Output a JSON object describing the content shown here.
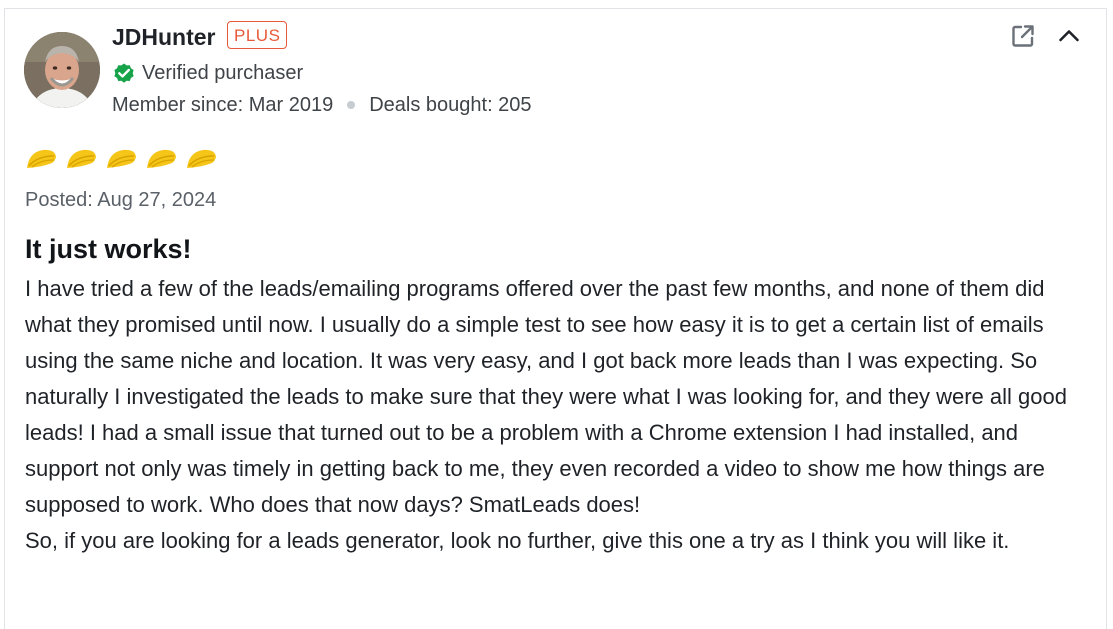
{
  "review": {
    "user": {
      "name": "JDHunter",
      "badge": "PLUS",
      "verified_label": "Verified purchaser",
      "member_since": "Member since: Mar 2019",
      "deals_bought": "Deals bought: 205",
      "avatar": "avatar-photo"
    },
    "actions": {
      "open_external_icon": "external-link-icon",
      "collapse_icon": "chevron-up-icon"
    },
    "rating": {
      "value": 5,
      "max": 5,
      "icon": "taco-icon",
      "color": "#f5c518"
    },
    "posted": "Posted: Aug 27, 2024",
    "title": "It just works!",
    "paragraphs": [
      "I have tried a few of the leads/emailing programs offered over the past few months, and none of them did what they promised until now. I usually do a simple test to see how easy it is to get a certain list of emails using the same niche and location. It was very easy, and I got back more leads than I was expecting. So naturally I investigated the leads to make sure that they were what I was looking for, and they were all good leads! I had a small issue that turned out to be a problem with a Chrome extension I had installed, and support not only was timely in getting back to me, they even recorded a video to show me how things are supposed to work. Who does that now days? SmatLeads does!",
      "So, if you are looking for a leads generator, look no further, give this one a try as I think you will like it."
    ]
  },
  "colors": {
    "badge": "#e8593a",
    "verified": "#17a34a",
    "taco": "#f5c518",
    "text": "#1f2328",
    "muted": "#5b6168"
  }
}
